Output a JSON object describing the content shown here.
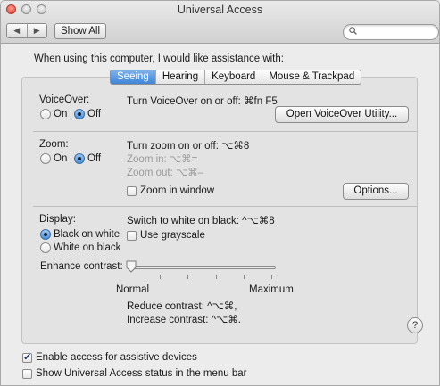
{
  "window": {
    "title": "Universal Access",
    "nav_back": "◀",
    "nav_forward": "▶",
    "show_all": "Show All",
    "search_placeholder": ""
  },
  "intro": "When using this computer, I would like assistance with:",
  "tabs": [
    {
      "label": "Seeing",
      "active": true
    },
    {
      "label": "Hearing",
      "active": false
    },
    {
      "label": "Keyboard",
      "active": false
    },
    {
      "label": "Mouse & Trackpad",
      "active": false
    }
  ],
  "voiceover": {
    "label": "VoiceOver:",
    "on": "On",
    "off": "Off",
    "selected": "Off",
    "shortcut_text": "Turn VoiceOver on or off: ⌘fn F5",
    "button": "Open VoiceOver Utility..."
  },
  "zoom": {
    "label": "Zoom:",
    "on": "On",
    "off": "Off",
    "selected": "Off",
    "shortcut_text": "Turn zoom on or off: ⌥⌘8",
    "zoom_in": "Zoom in: ⌥⌘=",
    "zoom_out": "Zoom out: ⌥⌘–",
    "zoom_in_window": "Zoom in window",
    "zoom_in_window_checked": false,
    "options_button": "Options..."
  },
  "display": {
    "label": "Display:",
    "black_on_white": "Black on white",
    "white_on_black": "White on black",
    "selected": "Black on white",
    "switch_text": "Switch to white on black: ^⌥⌘8",
    "grayscale": "Use grayscale",
    "grayscale_checked": false,
    "enhance_contrast": "Enhance contrast:",
    "slider_min": "Normal",
    "slider_max": "Maximum",
    "slider_value": 0,
    "reduce_contrast": "Reduce contrast: ^⌥⌘,",
    "increase_contrast": "Increase contrast: ^⌥⌘."
  },
  "help": "?",
  "footer": {
    "assistive": "Enable access for assistive devices",
    "assistive_checked": true,
    "menubar_status": "Show Universal Access status in the menu bar",
    "menubar_status_checked": false
  },
  "colors": {
    "selected_tab": "#4a8fdb",
    "close_button": "#e0443a"
  }
}
